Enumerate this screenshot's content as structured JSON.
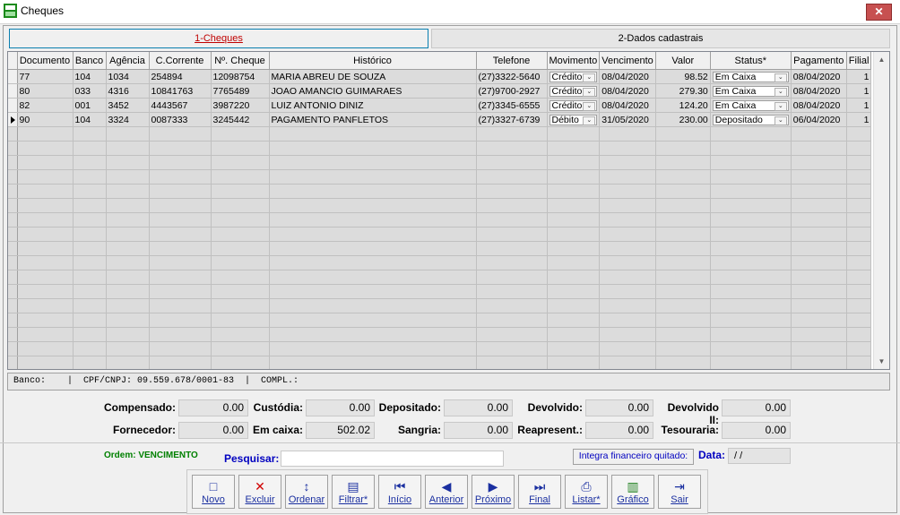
{
  "window": {
    "title": "Cheques",
    "close_label": "✕"
  },
  "tabs": [
    {
      "label": "1-Cheques"
    },
    {
      "label": "2-Dados cadastrais"
    }
  ],
  "grid": {
    "columns": [
      "Documento",
      "Banco",
      "Agência",
      "C.Corrente",
      "Nº. Cheque",
      "Histórico",
      "Telefone",
      "Movimento",
      "Vencimento",
      "Valor",
      "Status*",
      "Pagamento",
      "Filial"
    ],
    "rows": [
      {
        "documento": "77",
        "banco": "104",
        "agencia": "1034",
        "conta": "254894",
        "cheque": "12098754",
        "historico": "MARIA ABREU DE SOUZA",
        "telefone": "(27)3322-5640",
        "movimento": "Crédito",
        "vencimento": "08/04/2020",
        "valor": "98.52",
        "status": "Em Caixa",
        "pagamento": "08/04/2020",
        "filial": "1"
      },
      {
        "documento": "80",
        "banco": "033",
        "agencia": "4316",
        "conta": "10841763",
        "cheque": "7765489",
        "historico": "JOAO AMANCIO GUIMARAES",
        "telefone": "(27)9700-2927",
        "movimento": "Crédito",
        "vencimento": "08/04/2020",
        "valor": "279.30",
        "status": "Em Caixa",
        "pagamento": "08/04/2020",
        "filial": "1"
      },
      {
        "documento": "82",
        "banco": "001",
        "agencia": "3452",
        "conta": "4443567",
        "cheque": "3987220",
        "historico": "LUIZ ANTONIO DINIZ",
        "telefone": "(27)3345-6555",
        "movimento": "Crédito",
        "vencimento": "08/04/2020",
        "valor": "124.20",
        "status": "Em Caixa",
        "pagamento": "08/04/2020",
        "filial": "1"
      },
      {
        "documento": "90",
        "banco": "104",
        "agencia": "3324",
        "conta": "0087333",
        "cheque": "3245442",
        "historico": "PAGAMENTO PANFLETOS",
        "telefone": "(27)3327-6739",
        "movimento": "Débito",
        "vencimento": "31/05/2020",
        "valor": "230.00",
        "status": "Depositado",
        "pagamento": "06/04/2020",
        "filial": "1"
      }
    ],
    "current_row": 3
  },
  "statusline": "Banco:    |  CPF/CNPJ: 09.559.678/0001-83  |  COMPL.:",
  "totals": {
    "compensado": {
      "label": "Compensado:",
      "value": "0.00"
    },
    "custodia": {
      "label": "Custódia:",
      "value": "0.00"
    },
    "depositado": {
      "label": "Depositado:",
      "value": "0.00"
    },
    "devolvido": {
      "label": "Devolvido:",
      "value": "0.00"
    },
    "devolvido2": {
      "label": "Devolvido II:",
      "value": "0.00"
    },
    "fornecedor": {
      "label": "Fornecedor:",
      "value": "0.00"
    },
    "emcaixa": {
      "label": "Em caixa:",
      "value": "502.02"
    },
    "sangria": {
      "label": "Sangria:",
      "value": "0.00"
    },
    "reapresent": {
      "label": "Reapresent.:",
      "value": "0.00"
    },
    "tesouraria": {
      "label": "Tesouraria:",
      "value": "0.00"
    }
  },
  "ordem": "Ordem: VENCIMENTO",
  "search": {
    "label": "Pesquisar:",
    "value": ""
  },
  "integra_label": "Integra financeiro quitado:",
  "data": {
    "label": "Data:",
    "value": "/ /"
  },
  "toolbar": [
    {
      "name": "novo",
      "label": "Novo",
      "icon": "□"
    },
    {
      "name": "excluir",
      "label": "Excluir",
      "icon": "✕"
    },
    {
      "name": "ordenar",
      "label": "Ordenar",
      "icon": "↕"
    },
    {
      "name": "filtrar",
      "label": "Filtrar*",
      "icon": "▤"
    },
    {
      "name": "inicio",
      "label": "Início",
      "icon": "⏮"
    },
    {
      "name": "anterior",
      "label": "Anterior",
      "icon": "◀"
    },
    {
      "name": "proximo",
      "label": "Próximo",
      "icon": "▶"
    },
    {
      "name": "final",
      "label": "Final",
      "icon": "⏭"
    },
    {
      "name": "listar",
      "label": "Listar*",
      "icon": "⎙"
    },
    {
      "name": "grafico",
      "label": "Gráfico",
      "icon": "▥"
    },
    {
      "name": "sair",
      "label": "Sair",
      "icon": "⇥"
    }
  ],
  "colors": {
    "tab_active": "#c00000",
    "label_blue": "#0000c0",
    "ordem_green": "#008000"
  }
}
